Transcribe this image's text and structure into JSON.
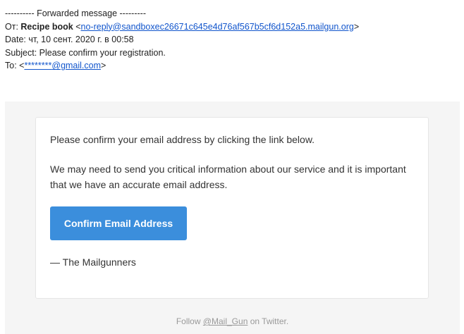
{
  "forwarded": {
    "separator": "---------- Forwarded message ---------",
    "from_label": "От: ",
    "from_name": "Recipe book",
    "from_open": " <",
    "from_email": "no-reply@sandboxec26671c645e4d76af567b5cf6d152a5.mailgun.org",
    "from_close": ">",
    "date": "Date: чт, 10 сент. 2020 г. в 00:58",
    "subject": "Subject: Please confirm your registration.",
    "to_label": "To: <",
    "to_masked": "********",
    "to_domain": "@gmail.com",
    "to_close": ">"
  },
  "email": {
    "line1": "Please confirm your email address by clicking the link below.",
    "line2": "We may need to send you critical information about our service and it is important that we have an accurate email address.",
    "button_label": "Confirm Email Address",
    "signature": "— The Mailgunners"
  },
  "footer": {
    "prefix": "Follow ",
    "link": "@Mail_Gun",
    "suffix": " on Twitter."
  },
  "colors": {
    "button": "#3b8edc",
    "link": "#1155cc",
    "band": "#f5f5f5"
  }
}
